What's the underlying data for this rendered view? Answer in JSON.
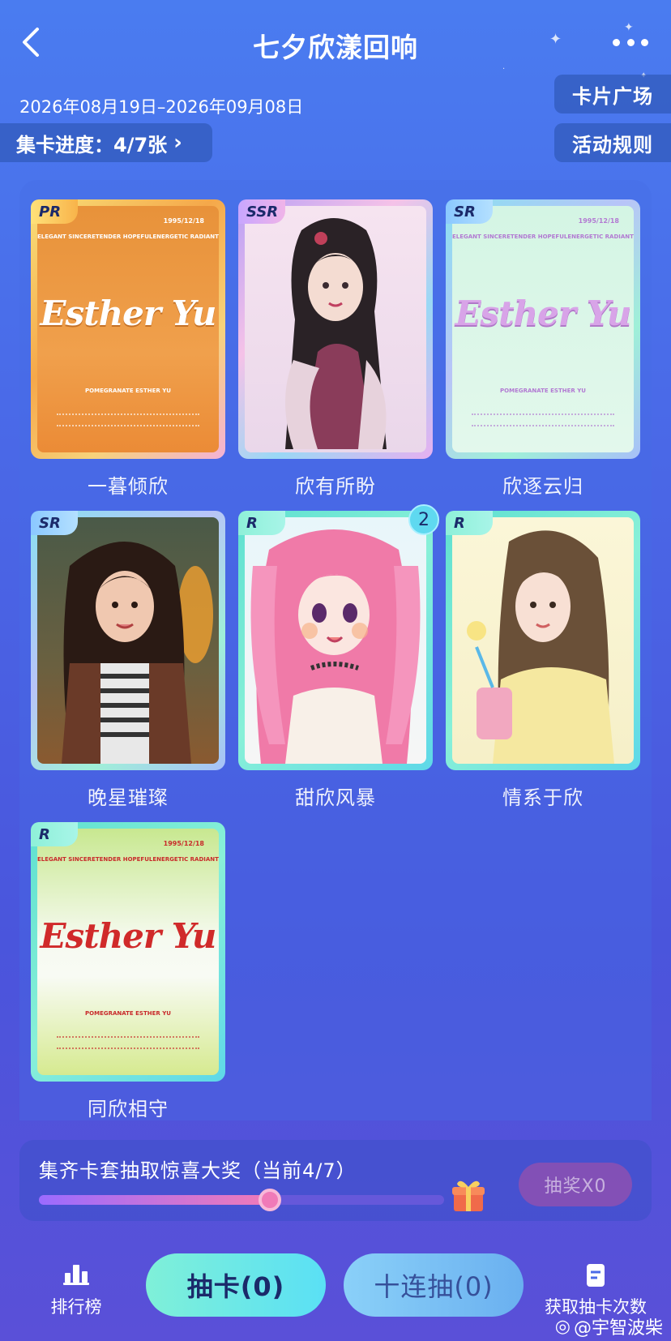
{
  "header": {
    "title": "七夕欣漾回响",
    "back_icon": "chevron-left-icon",
    "more_icon": "more-dots-icon"
  },
  "date_range": "2026年08月19日–2026年09月08日",
  "progress": {
    "label": "集卡进度：4/7张",
    "chevron": "›"
  },
  "buttons": {
    "card_square": "卡片广场",
    "rules": "活动规则"
  },
  "cards": [
    {
      "name": "一暮倾欣",
      "rarity": "PR",
      "style": "poster",
      "owned": true
    },
    {
      "name": "欣有所盼",
      "rarity": "SSR",
      "style": "portrait",
      "owned": true
    },
    {
      "name": "欣逐云归",
      "rarity": "SR",
      "style": "poster",
      "owned": true
    },
    {
      "name": "晚星璀璨",
      "rarity": "SR",
      "style": "portrait",
      "owned": true
    },
    {
      "name": "甜欣风暴",
      "rarity": "R",
      "style": "portrait",
      "owned": true,
      "count": "2"
    },
    {
      "name": "情系于欣",
      "rarity": "R",
      "style": "portrait",
      "owned": true
    },
    {
      "name": "同欣相守",
      "rarity": "R",
      "style": "poster",
      "owned": true
    }
  ],
  "poster": {
    "date": "1995/12/18",
    "tags": [
      "ELEGANT SINCERE",
      "TENDER HOPEFUL",
      "ENERGETIC RADIANT"
    ],
    "script": "Esther Yu",
    "sub": "POMEGRANATE ESTHER YU"
  },
  "reward": {
    "text": "集齐卡套抽取惊喜大奖（当前4/7）",
    "progress": 0.57,
    "button": "抽奖X0"
  },
  "bottom": {
    "rank_label": "排行榜",
    "draw_label": "抽卡(0)",
    "ten_label": "十连抽(0)",
    "get_label": "获取抽卡次数"
  },
  "watermark": "@宇智波柴",
  "colors": {
    "bg_top": "#4a7cf0",
    "bg_bottom": "#5a50d8",
    "cta": "#6ae8e8",
    "pink": "#f07ab8"
  }
}
